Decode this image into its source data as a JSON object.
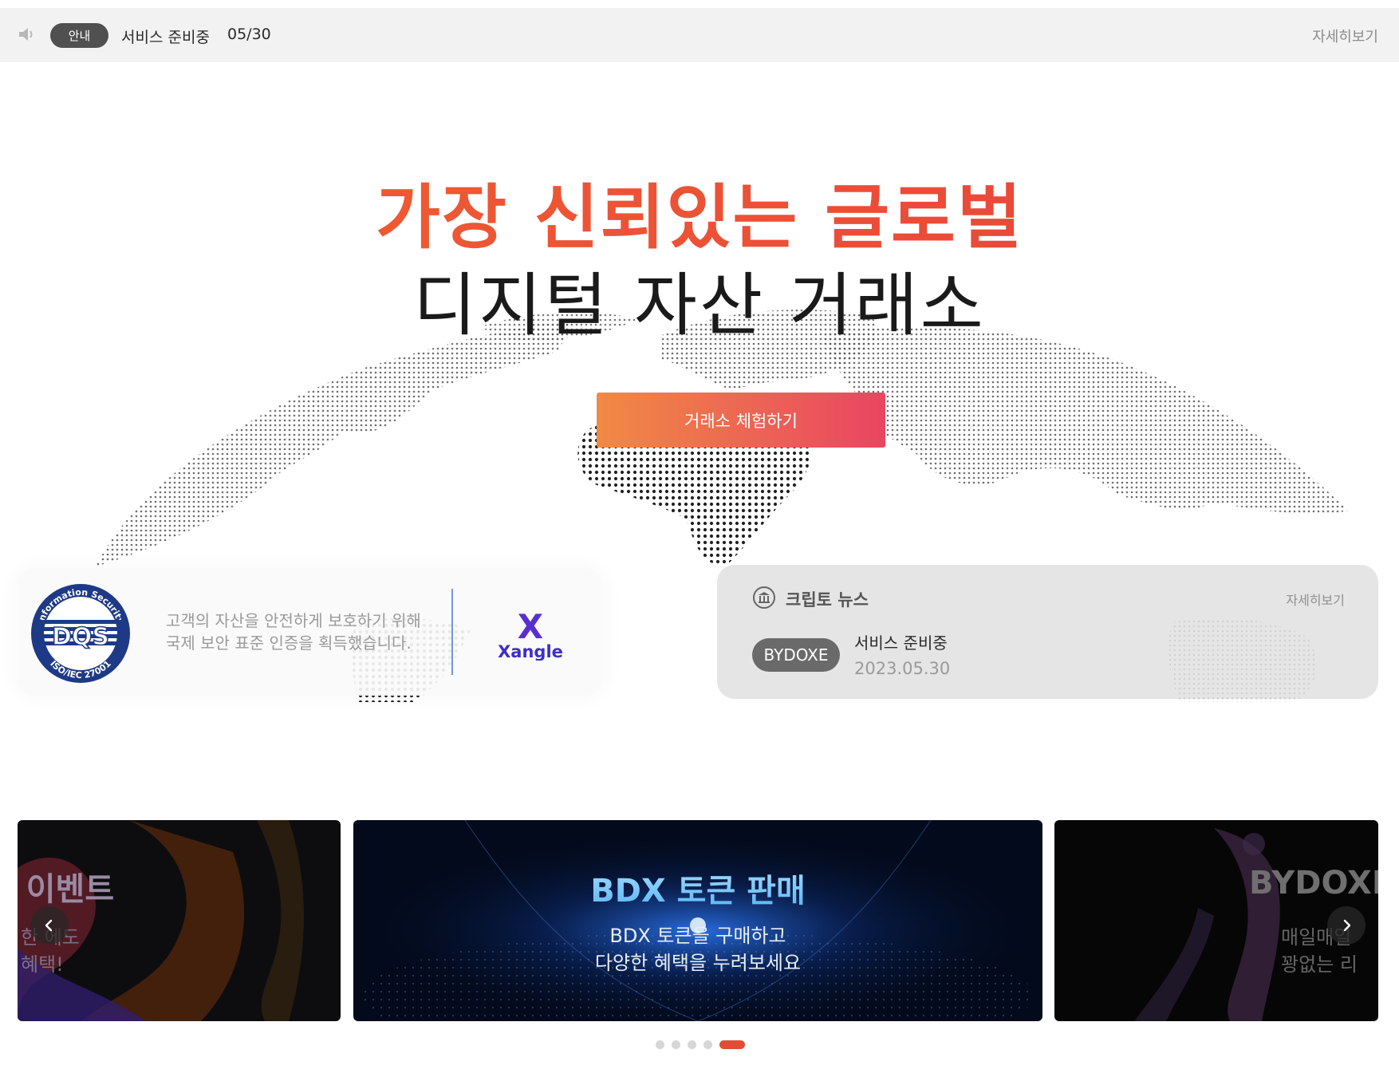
{
  "notice": {
    "badge": "안내",
    "text": "서비스 준비중",
    "date": "05/30",
    "more": "자세히보기"
  },
  "hero": {
    "line1": "가장 신뢰있는 글로벌",
    "line2": "디지털 자산 거래소",
    "cta": "거래소 체험하기",
    "accent_color": "#ee4b3a"
  },
  "certification": {
    "line1": "고객의 자산을 안전하게 보호하기 위해",
    "line2": "국제 보안 표준 인증을 획득했습니다.",
    "logo_dqs": {
      "top_text": "Information Security",
      "bottom_text": "ISO/IEC 27001",
      "center_text": "DQS"
    },
    "logo_xangle": {
      "mark": "X",
      "name": "Xangle"
    }
  },
  "news": {
    "title": "크립토 뉴스",
    "more": "자세히보기",
    "badge": "BYDOXE",
    "headline": "서비스 준비중",
    "date": "2023.05.30"
  },
  "carousel": {
    "slides": [
      {
        "title": "프 이벤트",
        "line1": "한 에도",
        "line2": "혜택!"
      },
      {
        "title": "BDX 토큰 판매",
        "line1": "BDX 토큰을 구매하고",
        "line2": "다양한 혜택을 누려보세요"
      },
      {
        "title": "BYDOXE",
        "line1": "매일매일",
        "line2": "꽝없는 리"
      }
    ],
    "dot_count": 5,
    "active_dot": 5
  }
}
